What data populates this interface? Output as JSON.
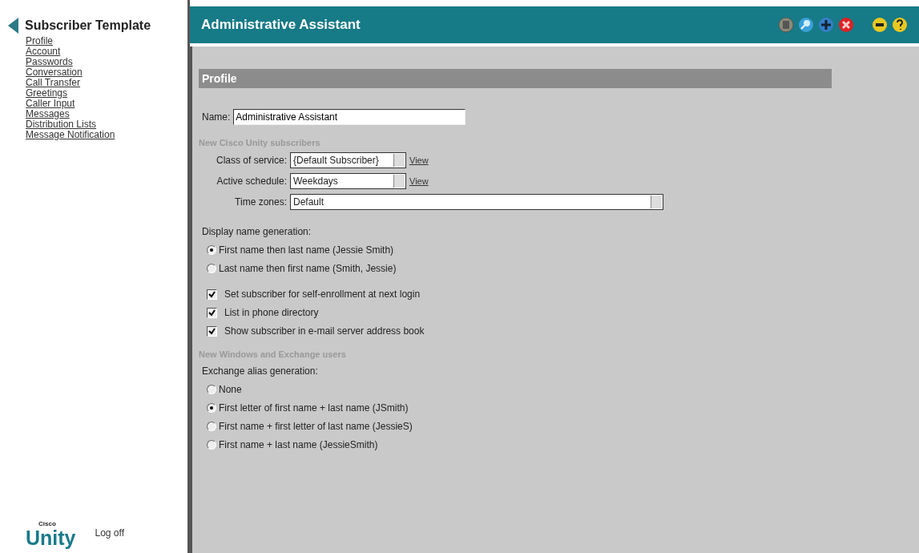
{
  "sidebar": {
    "title": "Subscriber Template",
    "items": [
      {
        "label": "Profile"
      },
      {
        "label": "Account"
      },
      {
        "label": "Passwords"
      },
      {
        "label": "Conversation"
      },
      {
        "label": "Call Transfer"
      },
      {
        "label": "Greetings"
      },
      {
        "label": "Caller Input"
      },
      {
        "label": "Messages"
      },
      {
        "label": "Distribution Lists"
      },
      {
        "label": "Message Notification"
      }
    ],
    "logo_small": "Cisco",
    "logo_large": "Unity",
    "logoff": "Log off"
  },
  "header": {
    "title": "Administrative Assistant"
  },
  "section": {
    "title": "Profile"
  },
  "name_field": {
    "label": "Name:",
    "value": "Administrative Assistant"
  },
  "group1": {
    "heading": "New Cisco Unity subscribers",
    "selects": [
      {
        "label": "Class of service:",
        "value": "{Default Subscriber}",
        "link": "View",
        "kind": "short"
      },
      {
        "label": "Active schedule:",
        "value": "Weekdays",
        "link": "View",
        "kind": "short"
      },
      {
        "label": "Time zones:",
        "value": "Default",
        "kind": "long"
      }
    ],
    "display_label": "Display name generation:",
    "display_options": [
      {
        "label": "First name then last name (Jessie Smith)",
        "selected": true
      },
      {
        "label": "Last name then first name (Smith, Jessie)",
        "selected": false
      }
    ],
    "checks": [
      {
        "label": "Set subscriber for self-enrollment at next login",
        "checked": true
      },
      {
        "label": "List in phone directory",
        "checked": true
      },
      {
        "label": "Show subscriber in e-mail server address book",
        "checked": true
      }
    ]
  },
  "group2": {
    "heading": "New Windows and Exchange users",
    "alias_label": "Exchange alias generation:",
    "alias_options": [
      {
        "label": "None",
        "selected": false
      },
      {
        "label": "First letter of first name + last name (JSmith)",
        "selected": true
      },
      {
        "label": "First name + first letter of last name (JessieS)",
        "selected": false
      },
      {
        "label": "First name + last name (JessieSmith)",
        "selected": false
      }
    ]
  }
}
